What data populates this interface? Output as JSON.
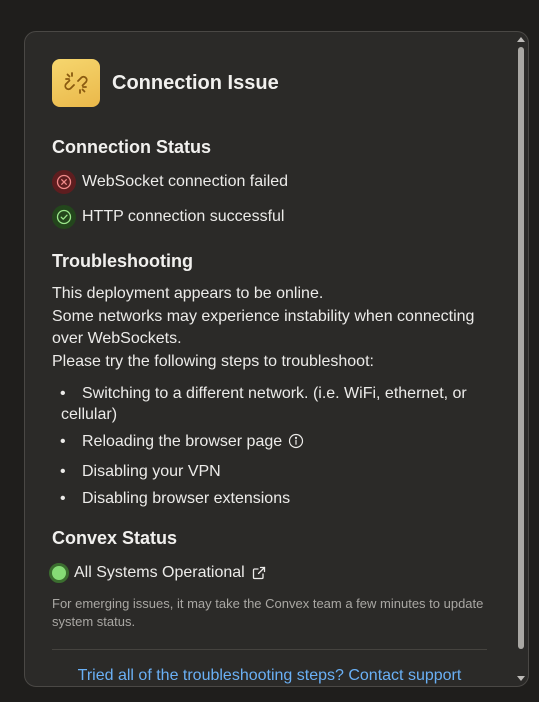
{
  "header": {
    "title": "Connection Issue",
    "icon": "broken-link-icon"
  },
  "connection_status": {
    "heading": "Connection Status",
    "items": [
      {
        "label": "WebSocket connection failed",
        "state": "failed",
        "icon": "x-circle-icon",
        "color": "#5e1d1f"
      },
      {
        "label": "HTTP connection successful",
        "state": "success",
        "icon": "check-circle-icon",
        "color": "#23461c"
      }
    ]
  },
  "troubleshooting": {
    "heading": "Troubleshooting",
    "lines": [
      "This deployment appears to be online.",
      "Some networks may experience instability when connecting over WebSockets.",
      "Please try the following steps to troubleshoot:"
    ],
    "steps": [
      "Switching to a different network. (i.e. WiFi, ethernet, or cellular)",
      "Reloading the browser page",
      "Disabling your VPN",
      "Disabling browser extensions"
    ]
  },
  "convex_status": {
    "heading": "Convex Status",
    "status_label": "All Systems Operational",
    "status_color": "#86db76",
    "note": "For emerging issues, it may take the Convex team a few minutes to update system status."
  },
  "footer": {
    "contact_link": "Tried all of the troubleshooting steps? Contact support",
    "link_color": "#6ab0f5"
  }
}
